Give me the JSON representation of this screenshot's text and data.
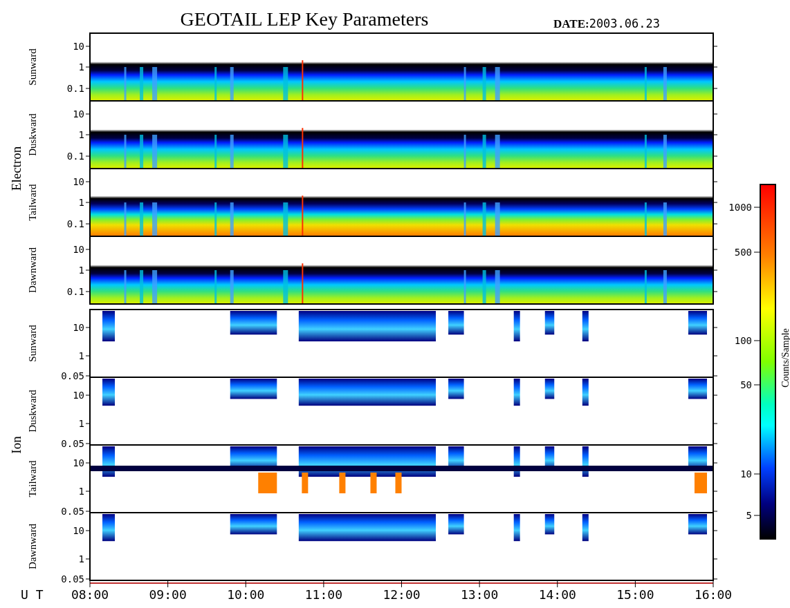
{
  "title": "GEOTAIL LEP Key Parameters",
  "date": {
    "label": "DATE:",
    "value": "2003.06.23"
  },
  "groups": [
    {
      "name": "Electron",
      "kind": "electron",
      "panels": [
        {
          "label": "Sunward",
          "yticks": [
            "10",
            "1",
            "0.1"
          ]
        },
        {
          "label": "Duskward",
          "yticks": [
            "10",
            "1",
            "0.1"
          ]
        },
        {
          "label": "Tailward",
          "yticks": [
            "10",
            "1",
            "0.1"
          ]
        },
        {
          "label": "Dawnward",
          "yticks": [
            "10",
            "1",
            "0.1"
          ]
        }
      ]
    },
    {
      "name": "Ion",
      "kind": "ion",
      "panels": [
        {
          "label": "Sunward",
          "yticks": [
            "10",
            "1",
            "0.05"
          ]
        },
        {
          "label": "Duskward",
          "yticks": [
            "10",
            "1",
            "0.05"
          ]
        },
        {
          "label": "Tailward",
          "yticks": [
            "10",
            "1",
            "0.05"
          ]
        },
        {
          "label": "Dawnward",
          "yticks": [
            "10",
            "1",
            "0.05"
          ]
        }
      ]
    }
  ],
  "time_axis": {
    "label": "U T",
    "ticks": [
      "08:00",
      "09:00",
      "10:00",
      "11:00",
      "12:00",
      "13:00",
      "14:00",
      "15:00",
      "16:00"
    ]
  },
  "colorbar": {
    "label": "Counts/Sample",
    "ticks": [
      "1000",
      "500",
      "100",
      "50",
      "10",
      "5"
    ]
  }
}
